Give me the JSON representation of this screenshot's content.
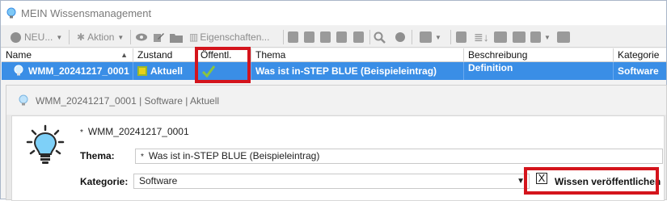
{
  "window": {
    "title": "MEIN Wissensmanagement"
  },
  "toolbar": {
    "new_label": "NEU...",
    "action_label": "Aktion",
    "properties_label": "Eigenschaften..."
  },
  "grid": {
    "columns": [
      "Name",
      "Zustand",
      "Öffentl.",
      "Thema",
      "Beschreibung",
      "Kategorie"
    ],
    "row": {
      "name": "WMM_20241217_0001",
      "zustand": "Aktuell",
      "thema": "Was ist in-STEP BLUE (Beispieleintrag)",
      "beschreibung": "Definition",
      "kategorie": "Software"
    }
  },
  "detail": {
    "header_text": "WMM_20241217_0001 | Software | Aktuell",
    "record_id": "WMM_20241217_0001",
    "required_mark": "*",
    "thema_label": "Thema:",
    "thema_value": "Was ist in-STEP BLUE (Beispieleintrag)",
    "kategorie_label": "Kategorie:",
    "kategorie_value": "Software",
    "publish_label": "Wissen veröffentlichen",
    "publish_checked": true,
    "publish_check_glyph": "X"
  },
  "colors": {
    "selection": "#3a8ee6",
    "highlight": "#d4141c",
    "check_green": "#8ac43f",
    "state_yellow": "#e8d21a"
  }
}
